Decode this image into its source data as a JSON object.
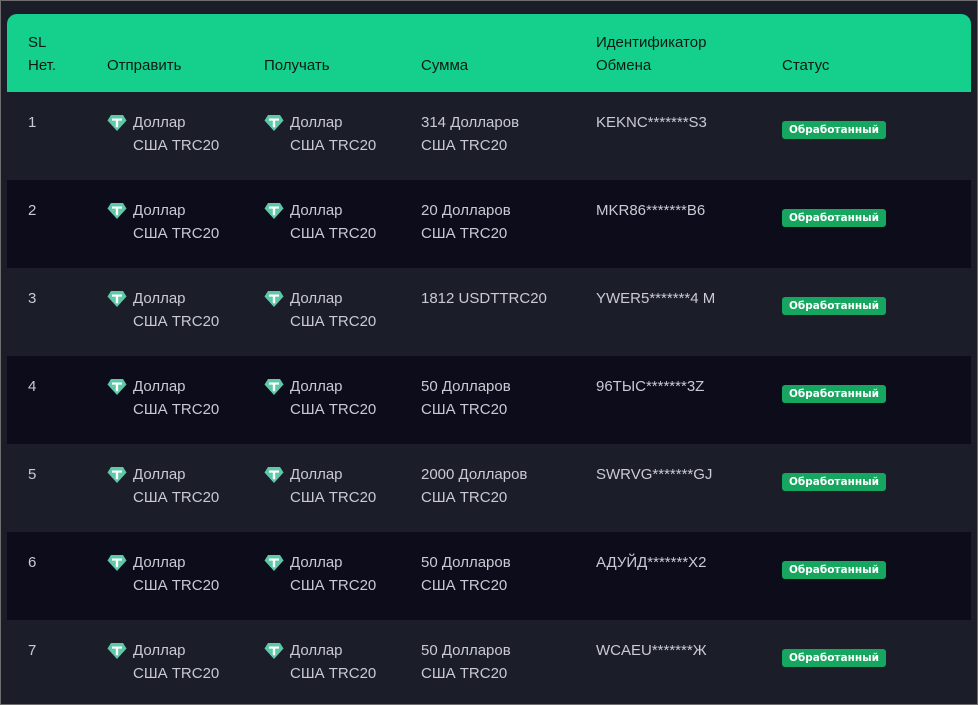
{
  "header": {
    "sl_line1": "SL",
    "sl_line2": "Нет.",
    "send": "Отправить",
    "receive": "Получать",
    "amount": "Сумма",
    "exchange_id_line1": "Идентификатор",
    "exchange_id_line2": "Обмена",
    "status": "Статус"
  },
  "colors": {
    "header_bg": "#14d08c",
    "row_bg_light": "#1b1d28",
    "row_bg_dark": "#0c0c1a",
    "badge_bg": "#17a660",
    "coin_icon": "#5fc8a7"
  },
  "rows": [
    {
      "sl": "1",
      "send_line1": "Доллар",
      "send_line2": "США TRC20",
      "recv_line1": "Доллар",
      "recv_line2": "США TRC20",
      "amount_line1": "314 Долларов",
      "amount_line2": "США TRC20",
      "exchange_id": "KEKNC*******S3",
      "status": "Обработанный",
      "icon": "tether-icon"
    },
    {
      "sl": "2",
      "send_line1": "Доллар",
      "send_line2": "США TRC20",
      "recv_line1": "Доллар",
      "recv_line2": "США TRC20",
      "amount_line1": "20 Долларов",
      "amount_line2": "США TRC20",
      "exchange_id": "MKR86*******B6",
      "status": "Обработанный",
      "icon": "tether-icon"
    },
    {
      "sl": "3",
      "send_line1": "Доллар",
      "send_line2": "США TRC20",
      "recv_line1": "Доллар",
      "recv_line2": "США TRC20",
      "amount_line1": "1812 USDTTRC20",
      "amount_line2": "",
      "exchange_id": "YWER5*******4 M",
      "status": "Обработанный",
      "icon": "tether-icon"
    },
    {
      "sl": "4",
      "send_line1": "Доллар",
      "send_line2": "США TRC20",
      "recv_line1": "Доллар",
      "recv_line2": "США TRC20",
      "amount_line1": "50 Долларов",
      "amount_line2": "США TRC20",
      "exchange_id": "96ТЫС*******3Z",
      "status": "Обработанный",
      "icon": "tether-icon"
    },
    {
      "sl": "5",
      "send_line1": "Доллар",
      "send_line2": "США TRC20",
      "recv_line1": "Доллар",
      "recv_line2": "США TRC20",
      "amount_line1": "2000 Долларов",
      "amount_line2": "США TRC20",
      "exchange_id": "SWRVG*******GJ",
      "status": "Обработанный",
      "icon": "tether-icon"
    },
    {
      "sl": "6",
      "send_line1": "Доллар",
      "send_line2": "США TRC20",
      "recv_line1": "Доллар",
      "recv_line2": "США TRC20",
      "amount_line1": "50 Долларов",
      "amount_line2": "США TRC20",
      "exchange_id": "АДУЙД*******X2",
      "status": "Обработанный",
      "icon": "tether-icon"
    },
    {
      "sl": "7",
      "send_line1": "Доллар",
      "send_line2": "США TRC20",
      "recv_line1": "Доллар",
      "recv_line2": "США TRC20",
      "amount_line1": "50 Долларов",
      "amount_line2": "США TRC20",
      "exchange_id": "WCAEU*******Ж",
      "status": "Обработанный",
      "icon": "tether-icon"
    }
  ]
}
